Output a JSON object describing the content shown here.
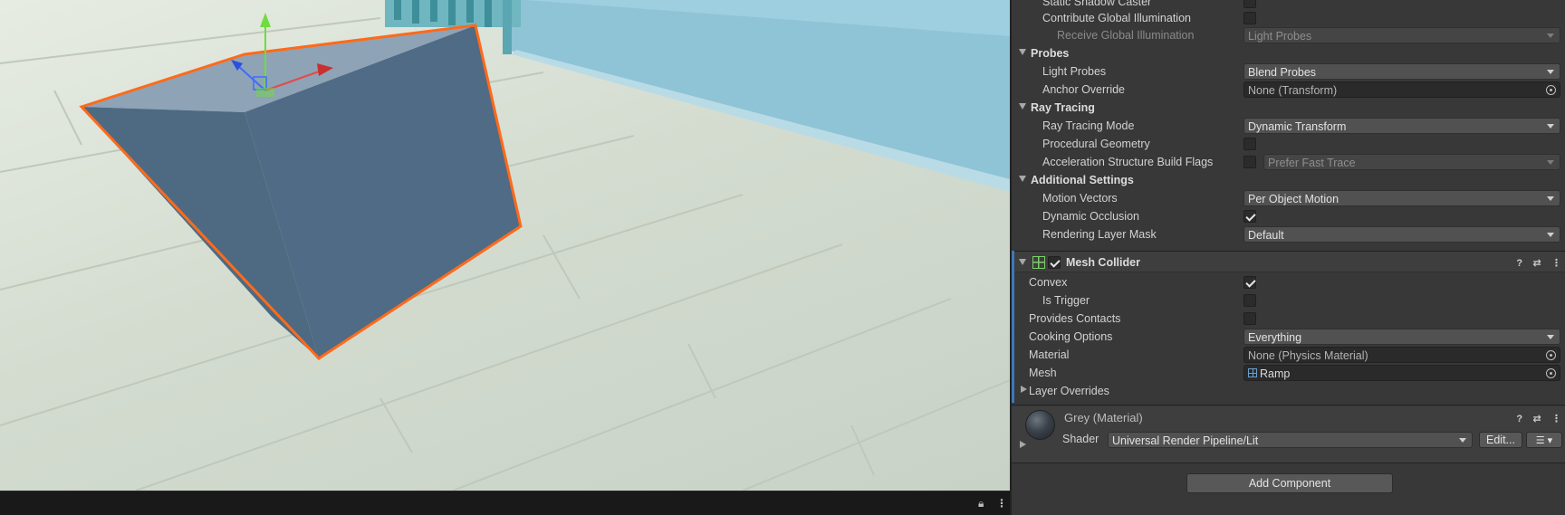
{
  "scene": {
    "lock_icon": "lock-icon",
    "menu_icon": "kebab-menu-icon"
  },
  "inspector": {
    "renderer": {
      "static_shadow_caster": "Static Shadow Caster",
      "contribute_gi": "Contribute Global Illumination",
      "receive_gi_label": "Receive Global Illumination",
      "receive_gi_value": "Light Probes",
      "probes_header": "Probes",
      "light_probes_label": "Light Probes",
      "light_probes_value": "Blend Probes",
      "anchor_override_label": "Anchor Override",
      "anchor_override_value": "None (Transform)",
      "ray_tracing_header": "Ray Tracing",
      "ray_tracing_mode_label": "Ray Tracing Mode",
      "ray_tracing_mode_value": "Dynamic Transform",
      "procedural_geometry_label": "Procedural Geometry",
      "accel_flags_label": "Acceleration Structure Build Flags",
      "accel_flags_value": "Prefer Fast Trace",
      "additional_header": "Additional Settings",
      "motion_vectors_label": "Motion Vectors",
      "motion_vectors_value": "Per Object Motion",
      "dynamic_occlusion_label": "Dynamic Occlusion",
      "rendering_layer_label": "Rendering Layer Mask",
      "rendering_layer_value": "Default"
    },
    "mesh_collider": {
      "title": "Mesh Collider",
      "convex_label": "Convex",
      "is_trigger_label": "Is Trigger",
      "provides_contacts_label": "Provides Contacts",
      "cooking_options_label": "Cooking Options",
      "cooking_options_value": "Everything",
      "material_label": "Material",
      "material_value": "None (Physics Material)",
      "mesh_label": "Mesh",
      "mesh_value": "Ramp",
      "layer_overrides_label": "Layer Overrides"
    },
    "material": {
      "title": "Grey (Material)",
      "shader_label": "Shader",
      "shader_value": "Universal Render Pipeline/Lit",
      "edit_label": "Edit..."
    },
    "add_component_label": "Add Component"
  },
  "colors": {
    "selection_outline": "#ff6a1a",
    "accent_blue": "#3a79bb",
    "inspector_bg": "#383838"
  }
}
